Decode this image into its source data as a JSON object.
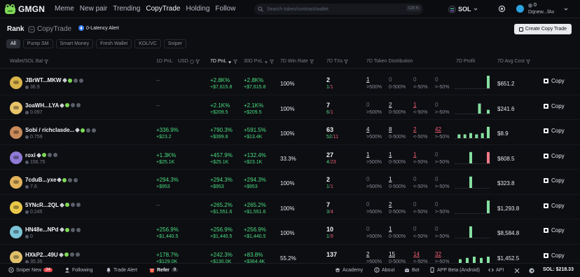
{
  "app": {
    "name": "GMGN"
  },
  "nav": [
    "Meme",
    "New pair",
    "Trending",
    "CopyTrade",
    "Holding",
    "Follow"
  ],
  "search": {
    "placeholder": "Search token/contract/wallet",
    "shortcut": "Ctrl K"
  },
  "chain": {
    "label": "SOL"
  },
  "wallet": {
    "balance": "0",
    "name": "Dqnew...fAv"
  },
  "page": {
    "title": "Rank",
    "subtitle": "CopyTrade",
    "latency_label": "0-Latency Alert",
    "create_button": "Create Copy Trade"
  },
  "tabs": [
    "All",
    "Pump SM",
    "Smart Money",
    "Fresh Wallet",
    "KOL/VC",
    "Sniper"
  ],
  "columns": {
    "wallet": "Wallet/SOL Bal",
    "pnl1d": "1D PnL",
    "usd": "USD",
    "pnl7d": "7D PnL",
    "pnl30d": "30D PnL",
    "winrate": "7D Win Rate",
    "txs": "7D TXs",
    "dist": "7D Token Distribution",
    "profit": "7D Profit",
    "cost": "7D Avg Cost"
  },
  "dist_labels": [
    ">500%",
    "0-500%",
    "<-50%",
    ">-50%"
  ],
  "copy_label": "Copy",
  "rows": [
    {
      "name": "JBrWT...MKW",
      "bal": "36.9",
      "pnl1d_pct": "--",
      "pnl1d_usd": "",
      "pnl7d_pct": "+2.8K%",
      "pnl7d_usd": "+$7,615.8",
      "pnl30d_pct": "+2.8K%",
      "pnl30d_usd": "+$7,615.8",
      "winrate": "100%",
      "txs": "2",
      "buys": "1",
      "sells": "1",
      "dist": [
        "1",
        "0",
        "0",
        "0"
      ],
      "bars": [
        0,
        0,
        0,
        1
      ],
      "avg_cost": "$651.2",
      "avatar": "#d9b44a"
    },
    {
      "name": "3oaWH...LYA",
      "bal": "0.097",
      "pnl1d_pct": "--",
      "pnl1d_usd": "",
      "pnl7d_pct": "+2.1K%",
      "pnl7d_usd": "+$209.5",
      "pnl30d_pct": "+2.1K%",
      "pnl30d_usd": "+$209.5",
      "winrate": "100%",
      "txs": "7",
      "buys": "6",
      "sells": "1",
      "dist": [
        "0",
        "2",
        "1",
        "0"
      ],
      "bars": [
        0,
        0,
        0.8,
        0.3
      ],
      "avg_cost": "$241.6",
      "avatar": "#e8c46a"
    },
    {
      "name": "Sobi / richclasde...",
      "bal": "0.759",
      "pnl1d_pct": "+336.9%",
      "pnl1d_usd": "+$23.2",
      "pnl7d_pct": "+790.3%",
      "pnl7d_usd": "+$399.8",
      "pnl30d_pct": "+591.5%",
      "pnl30d_usd": "+$13.4K",
      "winrate": "100%",
      "txs": "63",
      "buys": "52",
      "sells": "11",
      "dist": [
        "4",
        "8",
        "2",
        "42"
      ],
      "bars": [
        0.3,
        0.3,
        0.4,
        0.3,
        0.4,
        0.9
      ],
      "avg_cost": "$8.9",
      "avatar": "#c98b5a"
    },
    {
      "name": "roxi",
      "bal": "156.75",
      "pnl1d_pct": "+1.3K%",
      "pnl1d_usd": "+$25.1K",
      "pnl7d_pct": "+457.9%",
      "pnl7d_usd": "+$25.1K",
      "pnl30d_pct": "+132.4%",
      "pnl30d_usd": "+$23.1K",
      "winrate": "33.3%",
      "txs": "27",
      "buys": "4",
      "sells": "23",
      "dist": [
        "1",
        "1",
        "1",
        "0"
      ],
      "bars": [
        0,
        0.9,
        0,
        -0.9
      ],
      "avg_cost": "$608.5",
      "avatar": "#8f7ad6"
    },
    {
      "name": "7cduB...yxe",
      "bal": "7.6",
      "pnl1d_pct": "+294.3%",
      "pnl1d_usd": "+$953",
      "pnl7d_pct": "+294.3%",
      "pnl7d_usd": "+$953",
      "pnl30d_pct": "+294.3%",
      "pnl30d_usd": "+$953",
      "winrate": "100%",
      "txs": "2",
      "buys": "1",
      "sells": "1",
      "dist": [
        "0",
        "1",
        "0",
        "0"
      ],
      "bars": [
        0,
        0.9,
        0,
        0
      ],
      "avg_cost": "$323.8",
      "avatar": "#e0b35c"
    },
    {
      "name": "5YNcR...2QL",
      "bal": "0.245",
      "pnl1d_pct": "--",
      "pnl1d_usd": "",
      "pnl7d_pct": "+265.2%",
      "pnl7d_usd": "+$1,551.6",
      "pnl30d_pct": "+265.2%",
      "pnl30d_usd": "+$1,551.6",
      "winrate": "100%",
      "txs": "7",
      "buys": "3",
      "sells": "4",
      "dist": [
        "0",
        "2",
        "0",
        "0"
      ],
      "bars": [
        0,
        0,
        0,
        1
      ],
      "avg_cost": "$1,293.8",
      "avatar": "#e8c84a"
    },
    {
      "name": "HN48e...NPd",
      "bal": "0",
      "pnl1d_pct": "+256.9%",
      "pnl1d_usd": "+$1,440.5",
      "pnl7d_pct": "+256.9%",
      "pnl7d_usd": "+$1,440.5",
      "pnl30d_pct": "+256.9%",
      "pnl30d_usd": "+$1,440.5",
      "winrate": "100%",
      "txs": "10",
      "buys": "1",
      "sells": "9",
      "dist": [
        "0",
        "1",
        "0",
        "0"
      ],
      "bars": [
        0,
        0.9,
        0,
        0
      ],
      "avg_cost": "$8,584.8",
      "avatar": "#7cc4d6"
    },
    {
      "name": "HXkP2...49U",
      "bal": "35.35",
      "pnl1d_pct": "+178.7%",
      "pnl1d_usd": "+$129.0K",
      "pnl7d_pct": "+242.3%",
      "pnl7d_usd": "+$130.0K",
      "pnl30d_pct": "+83.8%",
      "pnl30d_usd": "+$364.4K",
      "winrate": "55.2%",
      "txs": "137",
      "buys": "",
      "sells": "",
      "dist": [
        "2",
        "15",
        "14",
        "32"
      ],
      "bars": [
        0.3,
        0.4,
        0.5,
        0.4,
        0.5
      ],
      "avg_cost": "$1,452.5",
      "avatar": "#e0c06a"
    }
  ],
  "footer": {
    "sniper_new": "Sniper New",
    "sniper_count": "34",
    "following": "Following",
    "trade_alert": "Trade Alert",
    "refer": "Refer",
    "refer_count": "0",
    "academy": "Academy",
    "about": "About",
    "bot": "Bot",
    "app": "APP Beta (Android)",
    "api": "API",
    "sol_price": "SOL: $218.33"
  },
  "colors": {
    "green": "#4ade80",
    "red": "#f35e73",
    "bg": "#0d0e12",
    "bar_green": "#86e0a0",
    "bar_red": "#f07a86"
  }
}
